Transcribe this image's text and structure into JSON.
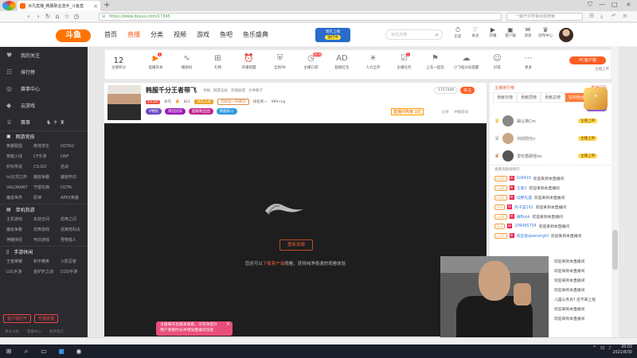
{
  "browser": {
    "tab_title": "冰凡直播_韩服职业选手_斗鱼直",
    "address": "https://www.douyu.com/17345",
    "search_placeholder": "一键开字符串标题搜索",
    "badge": "已开启"
  },
  "header": {
    "logo": "斗鱼",
    "menu": [
      "首页",
      "直播",
      "分类",
      "视频",
      "游戏",
      "鱼吧",
      "鱼乐盛典"
    ],
    "promo_line1": "现在上线",
    "promo_line2": "进行中",
    "search_placeholder": "冰凡元帅",
    "icons": [
      {
        "glyph": "⏱",
        "label": "历史"
      },
      {
        "glyph": "♡",
        "label": "关注"
      },
      {
        "glyph": "▶",
        "label": "开播"
      },
      {
        "glyph": "▣",
        "label": "客户端"
      },
      {
        "glyph": "✉",
        "label": "消息"
      },
      {
        "glyph": "♛",
        "label": "创作中心"
      }
    ]
  },
  "sidebar": {
    "items": [
      {
        "icon": "♥",
        "label": "我的关注"
      },
      {
        "icon": "☷",
        "label": "排行榜"
      },
      {
        "icon": "◎",
        "label": "赛事中心"
      },
      {
        "icon": "◆",
        "label": "云游戏"
      },
      {
        "icon": "♕",
        "label": "赛事"
      }
    ],
    "sections": [
      {
        "title": "网游竞技",
        "games": [
          "英雄联盟",
          "绝地求生",
          "DOTA2",
          "穿越火线",
          "CF手游",
          "DNF",
          "炉石传说",
          "CS:GO",
          "逆战",
          "lol云顶之弈",
          "魔兽争霸",
          "魔兽怀旧",
          "VALORANT",
          "守望先锋",
          "DOTA",
          "魔兽世界",
          "原神",
          "APEX英雄"
        ]
      },
      {
        "title": "单机热游",
        "games": [
          "主机游戏",
          "永劫无间",
          "恐怖之间",
          "魔兽争霸",
          "恐怖游戏",
          "逃离塔科夫",
          "神雕侠侣",
          "怀旧游戏",
          "怪物猎人"
        ]
      },
      {
        "title": "手游休闲",
        "games": [
          "王者荣耀",
          "和平精英",
          "火影忍者",
          "LOL手游",
          "金铲铲之战",
          "COD手游"
        ]
      }
    ],
    "bottom_buttons": [
      "客户端打开",
      "开播直播"
    ],
    "footer": [
      "更多分类",
      "客服中心",
      "联系我们"
    ]
  },
  "catbar": {
    "count": "12",
    "count_label": "主播积分",
    "items": [
      {
        "glyph": "▶",
        "label": "直播开关",
        "active": true,
        "badge": "1"
      },
      {
        "glyph": "∿",
        "label": "播放码"
      },
      {
        "glyph": "⊞",
        "label": "礼物"
      },
      {
        "glyph": "⏰",
        "label": "开播提醒"
      },
      {
        "glyph": "⛨",
        "label": "全民PK"
      },
      {
        "glyph": "◷",
        "label": "主播口袋",
        "badge": "NEW"
      },
      {
        "glyph": "AD",
        "label": "超级红包"
      },
      {
        "glyph": "☀",
        "label": "人力全开"
      },
      {
        "glyph": "☑",
        "label": "主播任务",
        "badge": "1"
      },
      {
        "glyph": "⚑",
        "label": "上车一起玩"
      },
      {
        "glyph": "☁",
        "label": "小飞船分段提醒"
      },
      {
        "glyph": "☺",
        "label": "好友"
      },
      {
        "glyph": "⋯",
        "label": "更多"
      }
    ],
    "pc_button": "PC客户端",
    "upload": "主播上传"
  },
  "room": {
    "title": "韩服千分王者带飞",
    "crumbs": [
      "举报",
      "网游竞技",
      "英雄联盟",
      "大神教学"
    ],
    "room_id": "1757449",
    "follow": "关注",
    "level": "Lv.16",
    "name": "冰凡",
    "hot": "821",
    "guild": "冰凡公会",
    "honor": "周榜第一周赛冠",
    "rank_text": "排名第一",
    "fans": "999+kg",
    "pills": [
      {
        "text": "V特权",
        "color": "#6b4bc6"
      },
      {
        "text": "周冠冠军",
        "color": "#9b1cba"
      },
      {
        "text": "超级粉丝团",
        "color": "#c0268f"
      },
      {
        "text": "周榜前十",
        "color": "#2e9be0"
      }
    ],
    "hot_badge": "直播间热度 1亿",
    "share": "分享",
    "report": "举报房间"
  },
  "player": {
    "retry": "重新加载",
    "tip_before": "您还可以",
    "tip_link": "下载客户端",
    "tip_after": "观看，获得纯净极速的观看体验",
    "toast_line1": "主播离开后再来观看，可有效提升",
    "toast_line2": "用户观看时长并增加直播间热度"
  },
  "right_panel": {
    "head_left": "主播排行榜",
    "head_right": "直播回看",
    "tabs": [
      "贡献日榜",
      "贡献周榜",
      "贡献总榜",
      "钻石粉丝"
    ],
    "become_fan": "成为粉丝",
    "ranks": [
      {
        "name": "踢以英Cm",
        "badge": "主播上神"
      },
      {
        "name": "刘的阳光n",
        "badge": "主播上神"
      },
      {
        "name": "爱吃香肠怪oo",
        "badge": "主播上神"
      }
    ],
    "more": "查看贡献榜排行",
    "chats": [
      {
        "lv": "Lv10",
        "name": "2x6419",
        "msg": "欢迎来到本直播间"
      },
      {
        "lv": "Lv26",
        "name": "王者2",
        "msg": "欢迎来到本直播间"
      },
      {
        "lv": "Lv21",
        "name": "炫野先遇",
        "msg": "欢迎来到本直播间"
      },
      {
        "lv": "Lv5",
        "name": "狗子菜101",
        "msg": "欢迎来到本直播间"
      },
      {
        "lv": "Lv24",
        "name": "悬Book",
        "msg": "欢迎来到本直播间"
      },
      {
        "lv": "Lv3",
        "name": "206495734",
        "msg": "欢迎来到本直播间"
      },
      {
        "lv": "Lv17",
        "name": "有些意qawrwrgttl",
        "msg": "欢迎来到本直播间"
      }
    ]
  },
  "edge_chat": [
    "欢迎来到本直播间",
    "欢迎来到本直播间",
    "欢迎来到本直播间",
    "欢迎来到本直播间",
    "儿是公务员? 还不来上班",
    "欢迎来到本直播间",
    "欢迎来到本直播间"
  ],
  "taskbar": {
    "time": "20:02",
    "date": "2021/8/30"
  }
}
